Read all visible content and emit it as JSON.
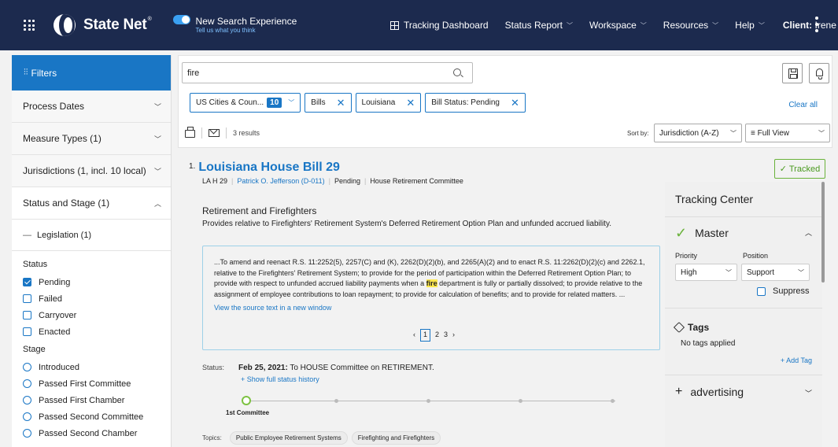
{
  "header": {
    "app_name": "State Net",
    "trademark": "®",
    "new_search_title": "New Search Experience",
    "new_search_sub": "Tell us what you think",
    "nav": {
      "tracking": "Tracking Dashboard",
      "status_report": "Status Report",
      "workspace": "Workspace",
      "resources": "Resources",
      "help": "Help"
    },
    "client_label": "Client:",
    "client_name": "Irene"
  },
  "sidebar": {
    "filters_label": "Filters",
    "sections": {
      "process_dates": "Process Dates",
      "measure_types": "Measure Types (1)",
      "jurisdictions": "Jurisdictions (1, incl. 10 local)",
      "status_stage": "Status and Stage (1)"
    },
    "legislation": "Legislation (1)",
    "status_label": "Status",
    "status_options": [
      {
        "label": "Pending",
        "checked": true
      },
      {
        "label": "Failed",
        "checked": false
      },
      {
        "label": "Carryover",
        "checked": false
      },
      {
        "label": "Enacted",
        "checked": false
      }
    ],
    "stage_label": "Stage",
    "stage_options": [
      "Introduced",
      "Passed First Committee",
      "Passed First Chamber",
      "Passed Second Committee",
      "Passed Second Chamber"
    ]
  },
  "search": {
    "query": "fire",
    "chips": {
      "cities": "US Cities & Coun...",
      "cities_count": "10",
      "bills": "Bills",
      "louisiana": "Louisiana",
      "bill_status": "Bill Status: Pending"
    },
    "clear_all": "Clear all",
    "results_count": "3 results",
    "sort_by_label": "Sort by:",
    "sort_value": "Jurisdiction (A-Z)",
    "view_value": "Full View"
  },
  "result": {
    "index": "1.",
    "title": "Louisiana House Bill 29",
    "bill_id": "LA H 29",
    "sponsor": "Patrick O. Jefferson (D-011)",
    "status": "Pending",
    "committee": "House Retirement Committee",
    "heading": "Retirement and Firefighters",
    "description": "Provides relative to Firefighters' Retirement System's Deferred Retirement Option Plan and unfunded accrued liability.",
    "excerpt_before": "...To amend and reenact R.S. 11:2252(5), 2257(C) and (K), 2262(D)(2)(b), and 2265(A)(2) and to enact R.S. 11:2262(D)(2)(c) and 2262.1, relative to the Firefighters' Retirement System; to provide for the period of participation within the Deferred Retirement Option Plan; to provide with respect to unfunded accrued liability payments when a ",
    "excerpt_highlight": "fire",
    "excerpt_after": " department is fully or partially dissolved; to provide relative to the assignment of employee contributions to loan repayment; to provide for calculation of benefits; and to provide for related matters. ...",
    "source_link": "View the source text in a new window",
    "pager": {
      "current": "1",
      "p2": "2",
      "p3": "3"
    },
    "status_label": "Status:",
    "status_date": "Feb 25, 2021:",
    "status_text": "To HOUSE Committee on RETIREMENT.",
    "history_link": "+ Show full status history",
    "timeline_label": "1st Committee",
    "topics_label": "Topics:",
    "topics": [
      "Public Employee Retirement Systems",
      "Firefighting and Firefighters"
    ]
  },
  "tracking": {
    "tracked_btn": "✓ Tracked",
    "center_title": "Tracking Center",
    "master": "Master",
    "priority_label": "Priority",
    "position_label": "Position",
    "priority_value": "High",
    "position_value": "Support",
    "suppress": "Suppress",
    "tags_title": "Tags",
    "no_tags": "No tags applied",
    "add_tag": "+ Add Tag",
    "advertising": "advertising"
  },
  "colors": {
    "topbar": "#1c2a4e",
    "accent": "#1976c5",
    "tracked_green": "#6ab23b",
    "highlight": "#ffe94d"
  },
  "icons": [
    "apps-grid-icon",
    "statenet-logo-icon",
    "toggle-icon",
    "tracking-grid-icon",
    "kebab-icon",
    "filter-icon",
    "chevron-icon",
    "search-icon",
    "save-icon",
    "bell-icon",
    "print-icon",
    "mail-icon",
    "check-icon",
    "tag-icon",
    "plus-icon"
  ]
}
